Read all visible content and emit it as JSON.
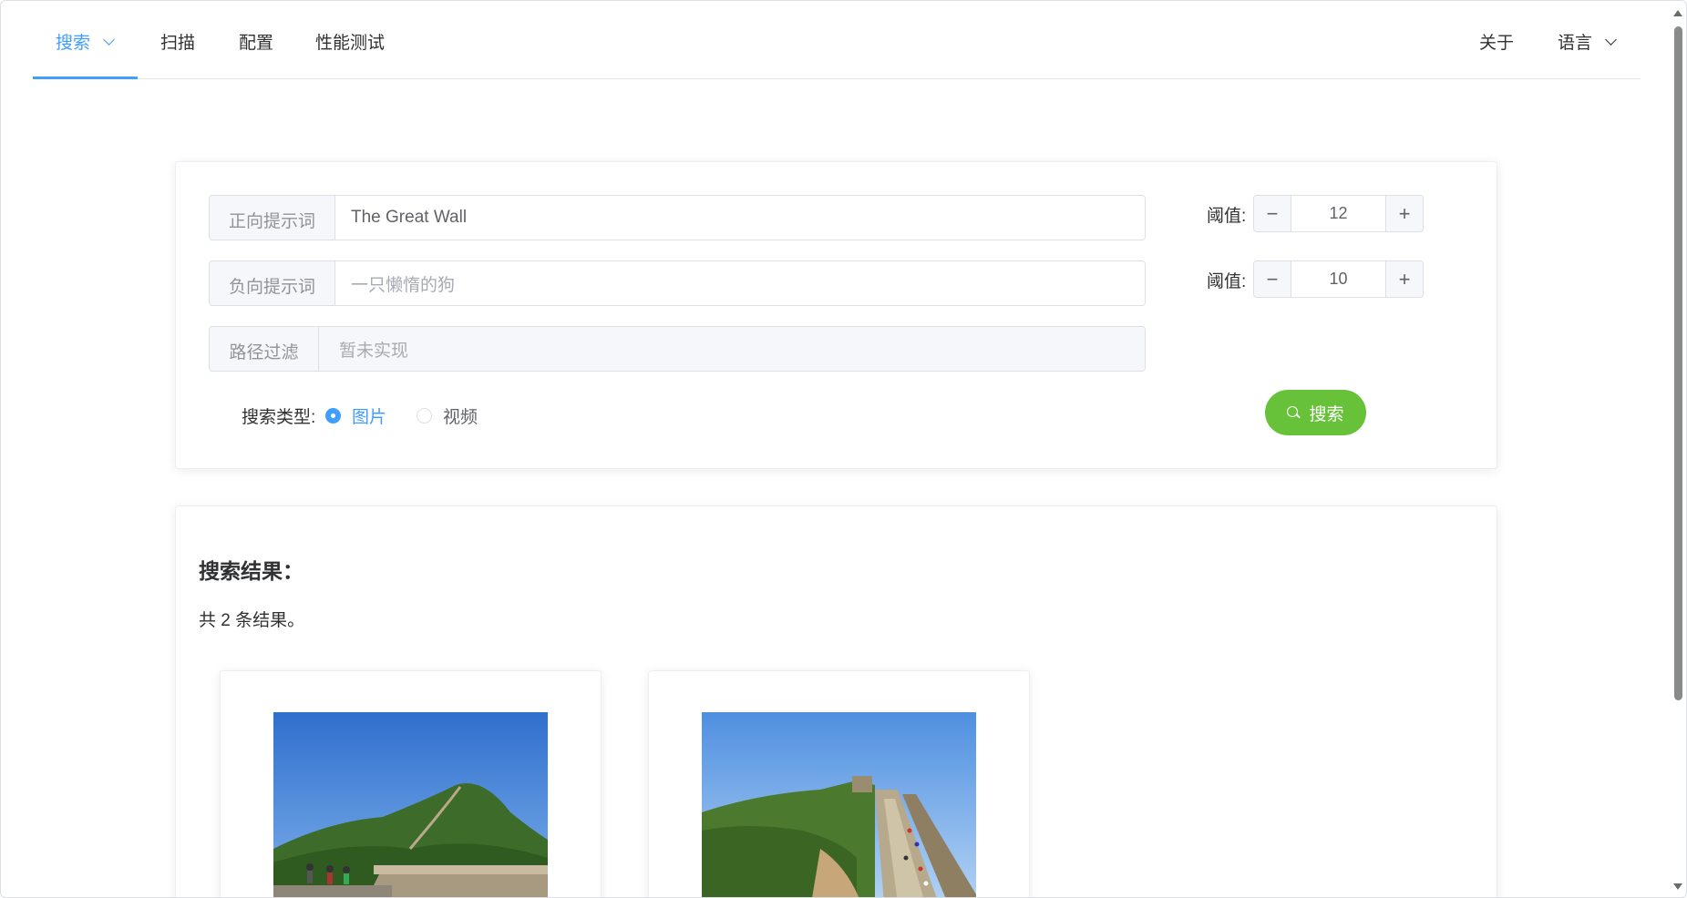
{
  "nav": {
    "items": [
      "搜索",
      "扫描",
      "配置",
      "性能测试"
    ],
    "about": "关于",
    "language": "语言"
  },
  "search": {
    "positive_label": "正向提示词",
    "positive_value": "The Great Wall",
    "negative_label": "负向提示词",
    "negative_placeholder": "一只懒惰的狗",
    "path_label": "路径过滤",
    "path_placeholder": "暂未实现",
    "threshold_label": "阈值:",
    "positive_threshold": "12",
    "negative_threshold": "10",
    "type_label": "搜索类型:",
    "type_options": [
      "图片",
      "视频"
    ],
    "type_selected": "图片",
    "search_button": "搜索"
  },
  "results": {
    "title": "搜索结果：",
    "count_text": "共 2 条结果。",
    "items": [
      {
        "image": "great-wall-photo-1"
      },
      {
        "image": "great-wall-photo-2"
      }
    ]
  },
  "colors": {
    "primary": "#409eff",
    "success": "#67c23a",
    "border": "#dcdfe6",
    "text": "#303133"
  }
}
